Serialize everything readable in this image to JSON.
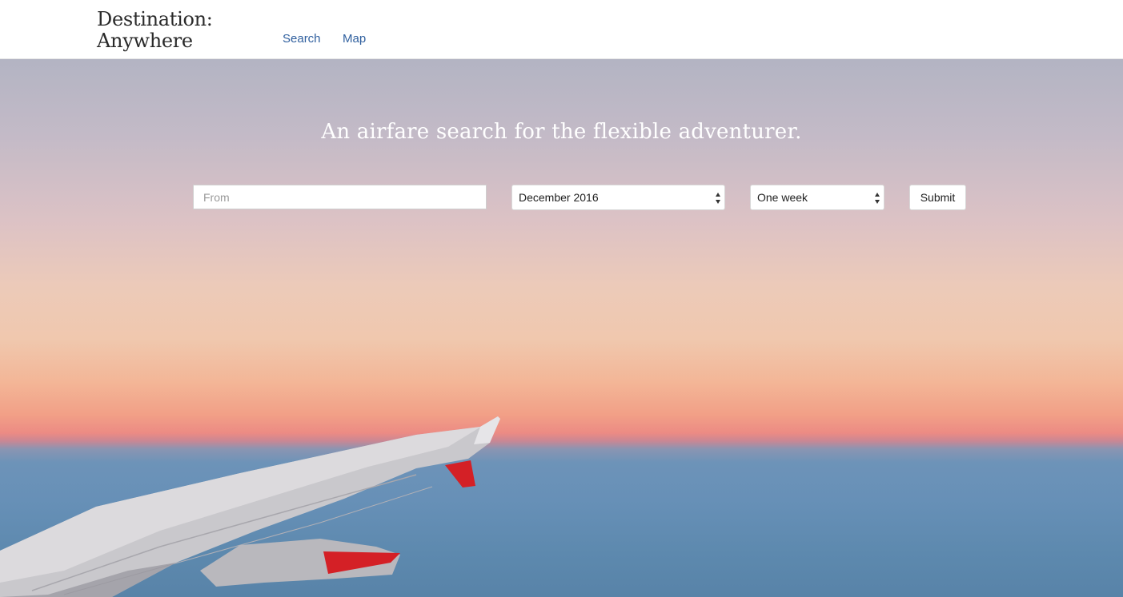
{
  "brand": {
    "line1": "Destination:",
    "line2": "Anywhere"
  },
  "nav": {
    "search_label": "Search",
    "map_label": "Map"
  },
  "hero": {
    "tagline": "An airfare search for the flexible adventurer."
  },
  "search_form": {
    "from_placeholder": "From",
    "from_value": "",
    "month_selected": "December 2016",
    "duration_selected": "One week",
    "submit_label": "Submit"
  },
  "colors": {
    "nav_link": "#2f5f9e",
    "brand_text": "#2a2a2a",
    "sky_top": "#b3b4c3",
    "horizon": "#ec8b84",
    "sea": "#6790b7",
    "wing_accent": "#d42026"
  },
  "icons": {
    "select_arrows": "updown-caret-icon"
  }
}
